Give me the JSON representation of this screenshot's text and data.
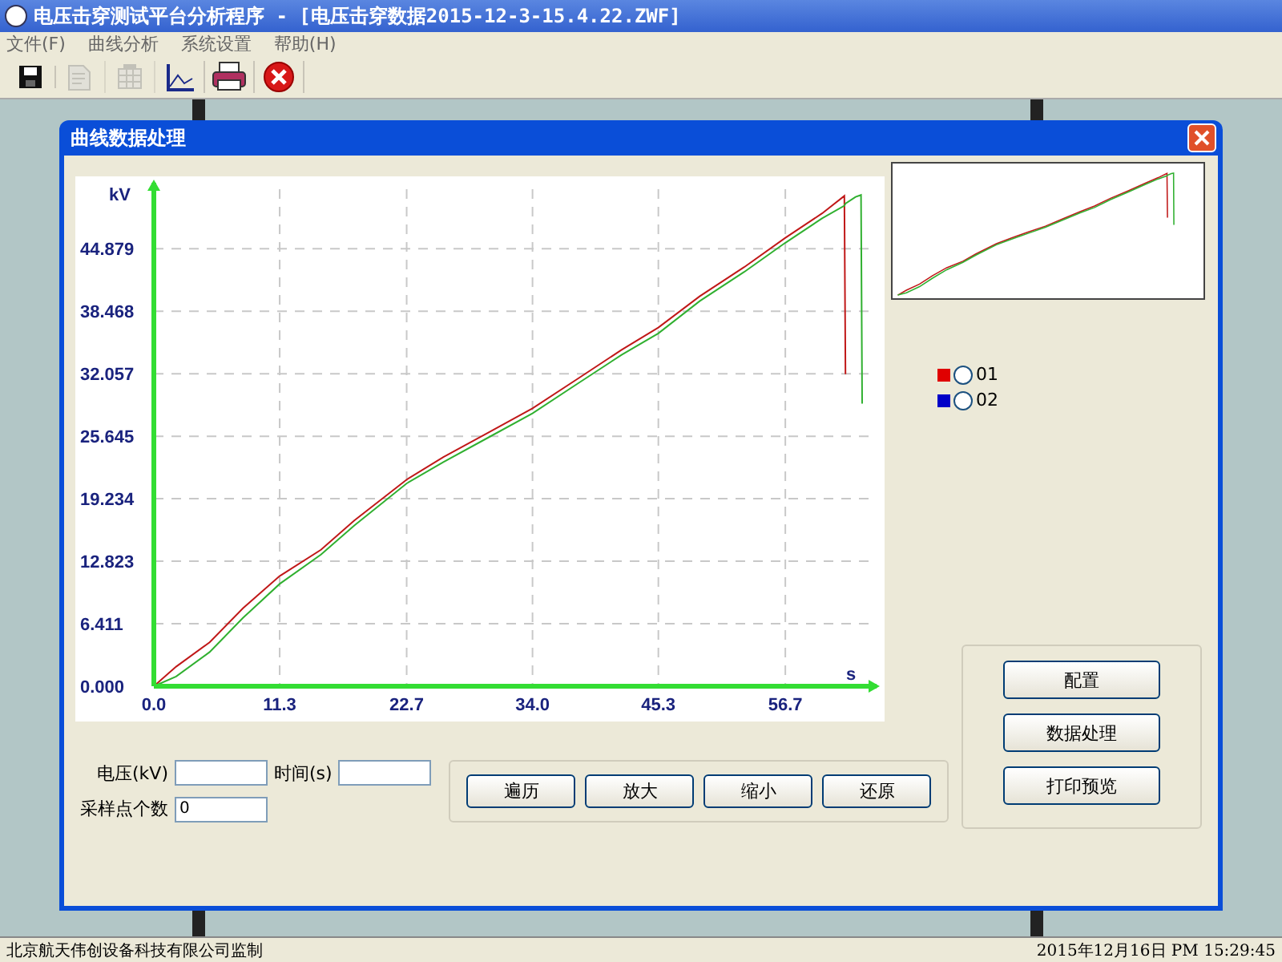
{
  "window": {
    "title": "电压击穿测试平台分析程序 - [电压击穿数据2015-12-3-15.4.22.ZWF]"
  },
  "menu": [
    {
      "label": "文件(F)"
    },
    {
      "label": "曲线分析"
    },
    {
      "label": "系统设置"
    },
    {
      "label": "帮助(H)"
    }
  ],
  "toolbar": [
    {
      "kind": "save",
      "disabled": false
    },
    {
      "kind": "edit",
      "disabled": true
    },
    {
      "kind": "table",
      "disabled": true
    },
    {
      "kind": "chart",
      "disabled": false
    },
    {
      "kind": "print",
      "disabled": false
    },
    {
      "kind": "exit",
      "disabled": false
    }
  ],
  "dialog": {
    "title": "曲线数据处理",
    "chart_data": {
      "type": "line",
      "ylabel": "kV",
      "xlabel": "s",
      "xlim": [
        0,
        65
      ],
      "ylim": [
        0,
        52
      ],
      "grid": true,
      "xticks": [
        {
          "value": 0,
          "label": "0.0"
        },
        {
          "value": 11.3,
          "label": "11.3"
        },
        {
          "value": 22.7,
          "label": "22.7"
        },
        {
          "value": 34,
          "label": "34.0"
        },
        {
          "value": 45.3,
          "label": "45.3"
        },
        {
          "value": 56.7,
          "label": "56.7"
        }
      ],
      "yticks": [
        {
          "value": 0,
          "label": "0.000"
        },
        {
          "value": 6.411,
          "label": "6.411"
        },
        {
          "value": 12.823,
          "label": "12.823"
        },
        {
          "value": 19.234,
          "label": "19.234"
        },
        {
          "value": 25.645,
          "label": "25.645"
        },
        {
          "value": 32.057,
          "label": "32.057"
        },
        {
          "value": 38.468,
          "label": "38.468"
        },
        {
          "value": 44.879,
          "label": "44.879"
        }
      ],
      "x": [
        0,
        2,
        5,
        8,
        11.3,
        15,
        18,
        22.7,
        26,
        30,
        34,
        38,
        42,
        45.3,
        49,
        53,
        56.7,
        60,
        62,
        62.1,
        63,
        63.5,
        63.6
      ],
      "series": [
        {
          "name": "01",
          "color": "#c01818",
          "values": [
            0,
            2,
            4.5,
            8,
            11.3,
            14,
            17,
            21.2,
            23.5,
            26,
            28.5,
            31.5,
            34.5,
            36.8,
            40,
            43,
            46,
            48.5,
            50.3,
            32,
            null,
            null,
            null
          ]
        },
        {
          "name": "02",
          "color": "#30b030",
          "values": [
            0,
            1,
            3.5,
            7,
            10.5,
            13.5,
            16.5,
            20.8,
            23,
            25.5,
            28,
            31,
            34,
            36.2,
            39.5,
            42.5,
            45.5,
            48,
            49.3,
            49.5,
            50.2,
            50.4,
            29
          ]
        }
      ]
    },
    "legend": [
      {
        "color": "#e00000",
        "selected": false
      },
      {
        "color": "#0000c8",
        "selected": false
      }
    ],
    "fields": [
      {
        "label": "电压(kV)"
      },
      {
        "label": "时间(s)"
      },
      {
        "label": "采样点个数",
        "value": "0"
      }
    ],
    "nav_buttons": [
      "遍历",
      "放大",
      "缩小",
      "还原"
    ],
    "side_buttons": [
      "配置",
      "数据处理",
      "打印预览"
    ]
  },
  "status_bar": {
    "left": "北京航天伟创设备科技有限公司监制",
    "right": "2015年12月16日 PM 15:29:45"
  }
}
